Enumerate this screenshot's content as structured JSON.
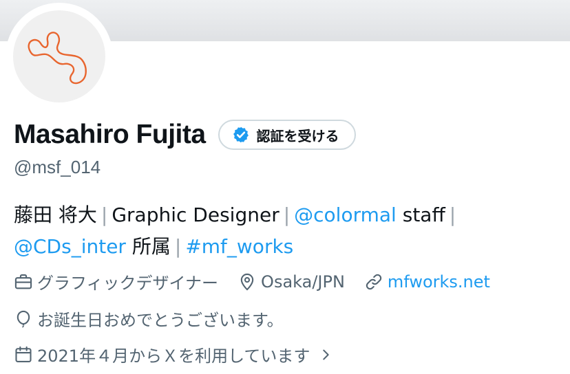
{
  "profile": {
    "display_name": "Masahiro Fujita",
    "handle": "@msf_014",
    "verify_button_label": "認証を受ける",
    "bio": {
      "part1": "藤田 将大",
      "sep": "|",
      "part2": "Graphic Designer",
      "mention1": "@colormal",
      "part3": "staff",
      "mention2": "@CDs_inter",
      "part4": "所属",
      "hashtag": "#mf_works"
    },
    "meta": {
      "category": "グラフィックデザイナー",
      "location": "Osaka/JPN",
      "website": "mfworks.net",
      "birthday": "お誕生日おめでとうございます。",
      "joined": "2021年４月からＸを利用しています"
    }
  },
  "icons": {
    "category": "briefcase-icon",
    "location": "map-pin-icon",
    "website": "link-icon",
    "birthday": "balloon-icon",
    "joined": "calendar-icon",
    "verify": "verified-badge-icon",
    "chevron": "chevron-right-icon"
  },
  "colors": {
    "accent": "#1d9bf0",
    "secondary_text": "#536471",
    "avatar_line": "#e8652e"
  }
}
